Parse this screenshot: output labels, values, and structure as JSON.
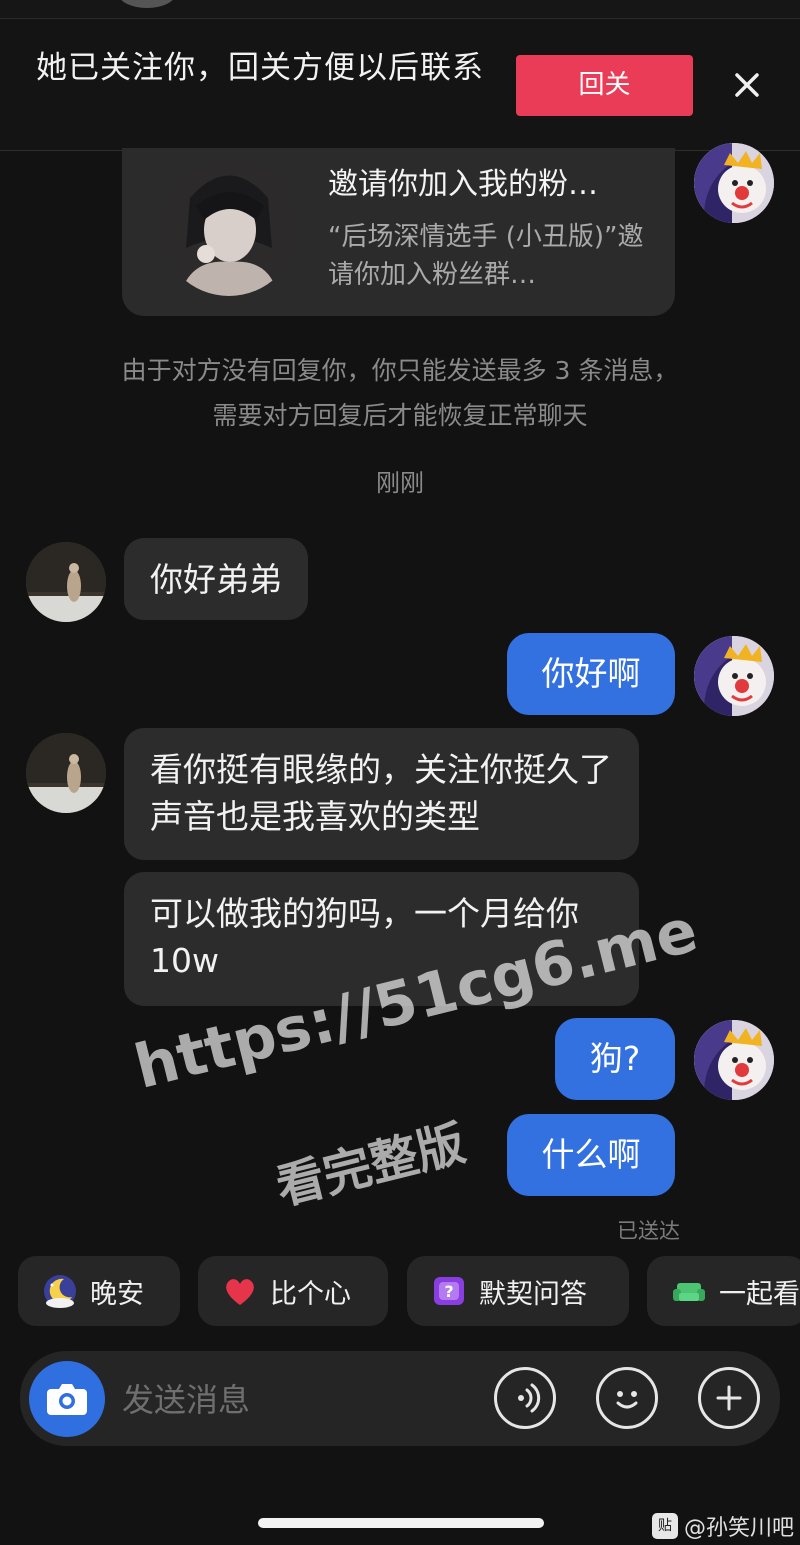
{
  "banner": {
    "text": "她已关注你，回关方便以后联系",
    "follow_back_label": "回关"
  },
  "invite_card": {
    "title": "邀请你加入我的粉…",
    "description": "“后场深情选手 (小丑版)”邀请你加入粉丝群…"
  },
  "notice": "由于对方没有回复你，你只能发送最多 3 条消息，需要对方回复后才能恢复正常聊天",
  "timestamp": "刚刚",
  "messages": [
    {
      "from": "her",
      "text": "你好弟弟"
    },
    {
      "from": "me",
      "text": "你好啊"
    },
    {
      "from": "her",
      "text": "看你挺有眼缘的，关注你挺久了声音也是我喜欢的类型"
    },
    {
      "from": "her",
      "text": "可以做我的狗吗，一个月给你 10w"
    },
    {
      "from": "me",
      "text": "狗?"
    },
    {
      "from": "me",
      "text": "什么啊"
    }
  ],
  "delivery_status": "已送达",
  "quick_replies": [
    {
      "icon": "moon-icon",
      "label": "晚安"
    },
    {
      "icon": "heart-icon",
      "label": "比个心"
    },
    {
      "icon": "question-icon",
      "label": "默契问答"
    },
    {
      "icon": "sofa-icon",
      "label": "一起看"
    }
  ],
  "input": {
    "placeholder": "发送消息"
  },
  "watermark": {
    "url": "https://51cg6.me",
    "caption": "看完整版"
  },
  "credit": "@孙笑川吧",
  "colors": {
    "background": "#121212",
    "incoming_bubble": "#2c2c2c",
    "outgoing_bubble": "#3471e0",
    "follow_button": "#ea3c56",
    "camera_button": "#2f6fdf"
  }
}
